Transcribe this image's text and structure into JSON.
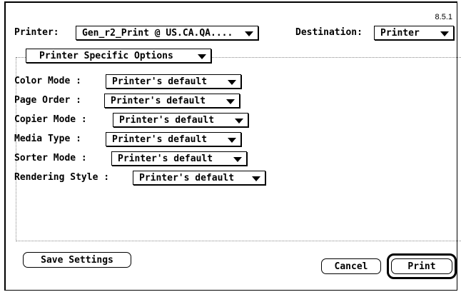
{
  "dialog": {
    "version": "8.5.1",
    "printer_label": "Printer:",
    "printer_value": "Gen_r2_Print @ US.CA.QA....",
    "destination_label": "Destination:",
    "destination_value": "Printer",
    "section_value": "Printer Specific Options"
  },
  "options": [
    {
      "label": "Color Mode :",
      "value": "Printer's default"
    },
    {
      "label": "Page Order :",
      "value": "Printer's default"
    },
    {
      "label": "Copier Mode :",
      "value": "Printer's default"
    },
    {
      "label": "Media Type :",
      "value": "Printer's default"
    },
    {
      "label": "Sorter Mode :",
      "value": "Printer's default"
    },
    {
      "label": "Rendering Style :",
      "value": "Printer's default"
    }
  ],
  "buttons": {
    "save_settings": "Save Settings",
    "cancel": "Cancel",
    "print": "Print"
  }
}
